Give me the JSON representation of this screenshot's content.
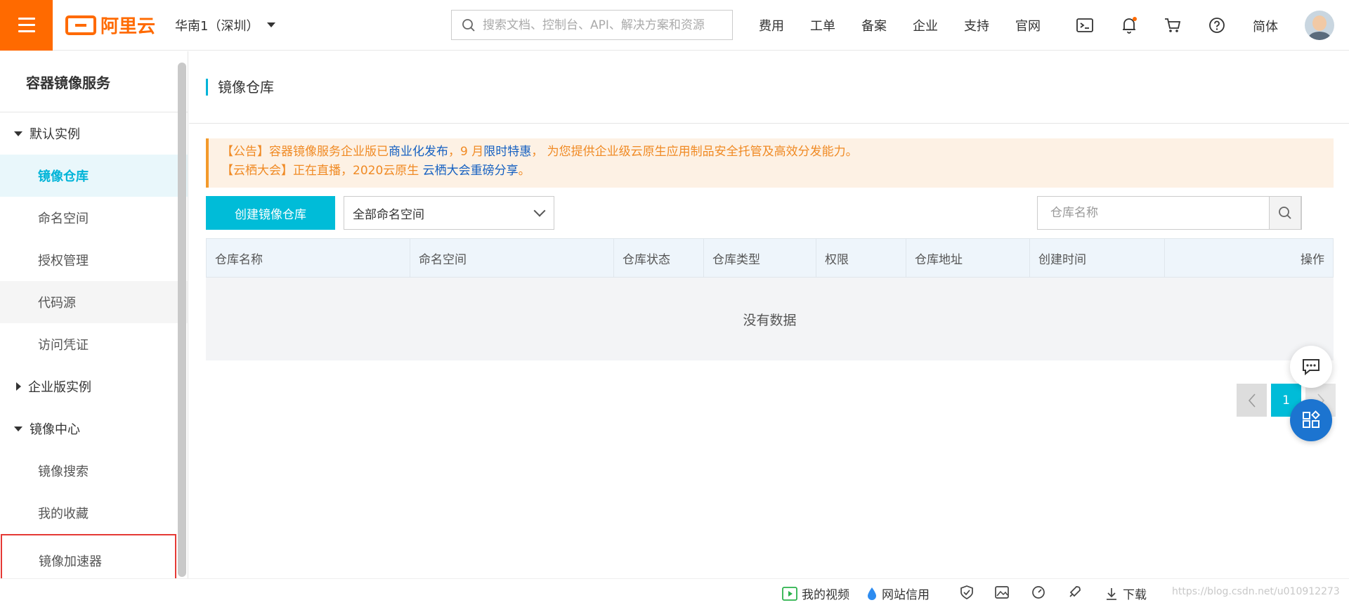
{
  "topbar": {
    "logo_text": "阿里云",
    "region": "华南1（深圳）",
    "search_placeholder": "搜索文档、控制台、API、解决方案和资源",
    "nav": [
      "费用",
      "工单",
      "备案",
      "企业",
      "支持",
      "官网"
    ],
    "lang": "简体",
    "accent_color": "#ff6a00"
  },
  "sidebar": {
    "title": "容器镜像服务",
    "groups": [
      {
        "label": "默认实例",
        "expanded": true,
        "items": [
          "镜像仓库",
          "命名空间",
          "授权管理",
          "代码源",
          "访问凭证"
        ]
      },
      {
        "label": "企业版实例",
        "expanded": false,
        "items": []
      },
      {
        "label": "镜像中心",
        "expanded": true,
        "items": [
          "镜像搜索",
          "我的收藏",
          "镜像加速器"
        ]
      }
    ],
    "active_item": "镜像仓库",
    "highlighted_item": "镜像加速器"
  },
  "main": {
    "title": "镜像仓库",
    "notice": {
      "line1_a": "【公告】容器镜像服务企业版已",
      "line1_link1": "商业化发布",
      "line1_b": "，9 月",
      "line1_link2": "限时特惠",
      "line1_c": "， 为您提供企业级云原生应用制品安全托管及高效分发能力。",
      "line2_a": "【云栖大会】正在直播，2020云原生 ",
      "line2_link": "云栖大会重磅分享",
      "line2_b": "。"
    },
    "create_button": "创建镜像仓库",
    "namespace_select": "全部命名空间",
    "repo_search_placeholder": "仓库名称",
    "table": {
      "columns": [
        "仓库名称",
        "命名空间",
        "仓库状态",
        "仓库类型",
        "权限",
        "仓库地址",
        "创建时间",
        "操作"
      ],
      "empty_text": "没有数据"
    },
    "pager": {
      "current": "1"
    }
  },
  "bottombar": {
    "video": "我的视频",
    "credit": "网站信用",
    "download": "下载",
    "watermark": "https://blog.csdn.net/u010912273"
  }
}
